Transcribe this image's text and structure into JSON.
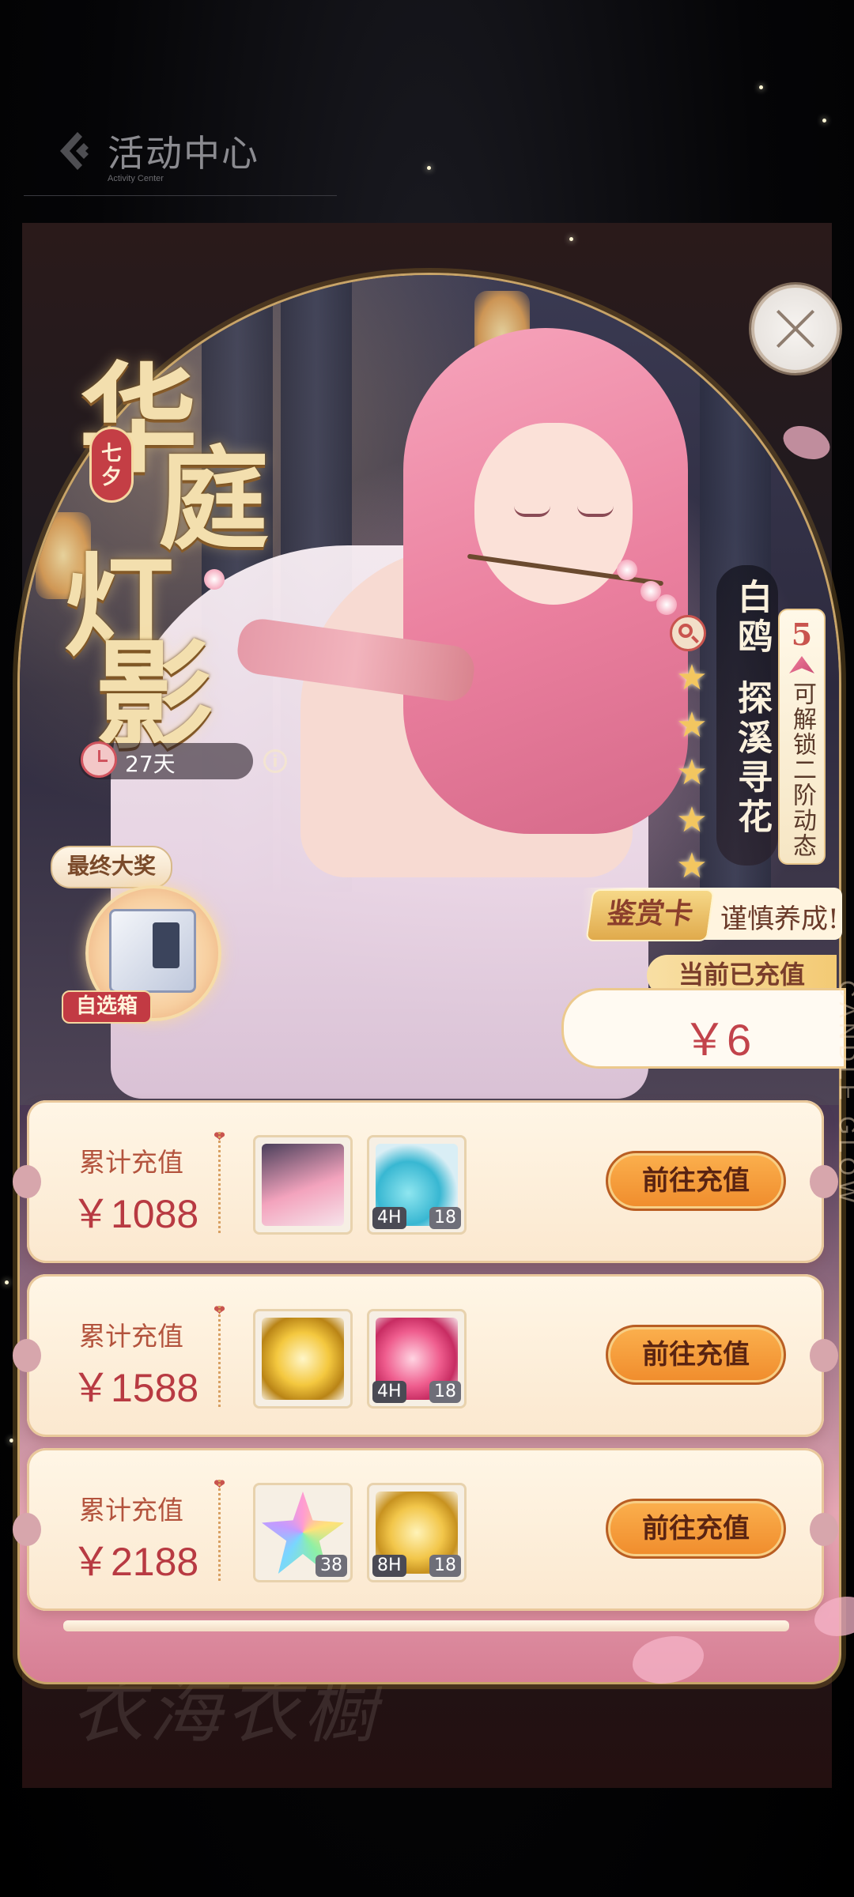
{
  "topbar": {
    "title": "活动中心",
    "subtitle": "Activity Center"
  },
  "background": {
    "lower_text": "衣海衣橱"
  },
  "event": {
    "title_chars": [
      "华",
      "庭",
      "灯",
      "影"
    ],
    "festival_tag": "七夕",
    "days_left": "27天",
    "final_prize_label": "最终大奖",
    "final_prize_tag": "自选箱",
    "side_text": "CANDLE GLOW"
  },
  "card": {
    "name": "白鸥",
    "subtitle": "探溪寻花",
    "rarity_number": "5",
    "rarity_text": "可解锁二阶动态",
    "stars": 5,
    "badge": "鉴赏卡",
    "badge_message": "谨慎养成!"
  },
  "recharge": {
    "current_label": "当前已充值",
    "current_value": "￥6"
  },
  "rows": [
    {
      "label": "累计充值",
      "amount": "￥1088",
      "items": [
        {
          "icon": "card-art-icon",
          "tl": "",
          "tr": ""
        },
        {
          "icon": "exp-coins-icon",
          "tl": "4H",
          "tr": "18"
        }
      ],
      "button": "前往充值"
    },
    {
      "label": "累计充值",
      "amount": "￥1588",
      "items": [
        {
          "icon": "gold-chest-icon",
          "tl": "",
          "tr": ""
        },
        {
          "icon": "pink-cubes-icon",
          "tl": "4H",
          "tr": "18"
        }
      ],
      "button": "前往充值"
    },
    {
      "label": "累计充值",
      "amount": "￥2188",
      "items": [
        {
          "icon": "rainbow-star-icon",
          "tl": "",
          "tr": "38"
        },
        {
          "icon": "gold-coins-icon",
          "tl": "8H",
          "tr": "18"
        }
      ],
      "button": "前往充值"
    }
  ],
  "colors": {
    "accent_gold": "#f3c660",
    "price_red": "#b83a42",
    "button_orange": "#f08c2c",
    "panel_cream": "#fff6e6"
  }
}
